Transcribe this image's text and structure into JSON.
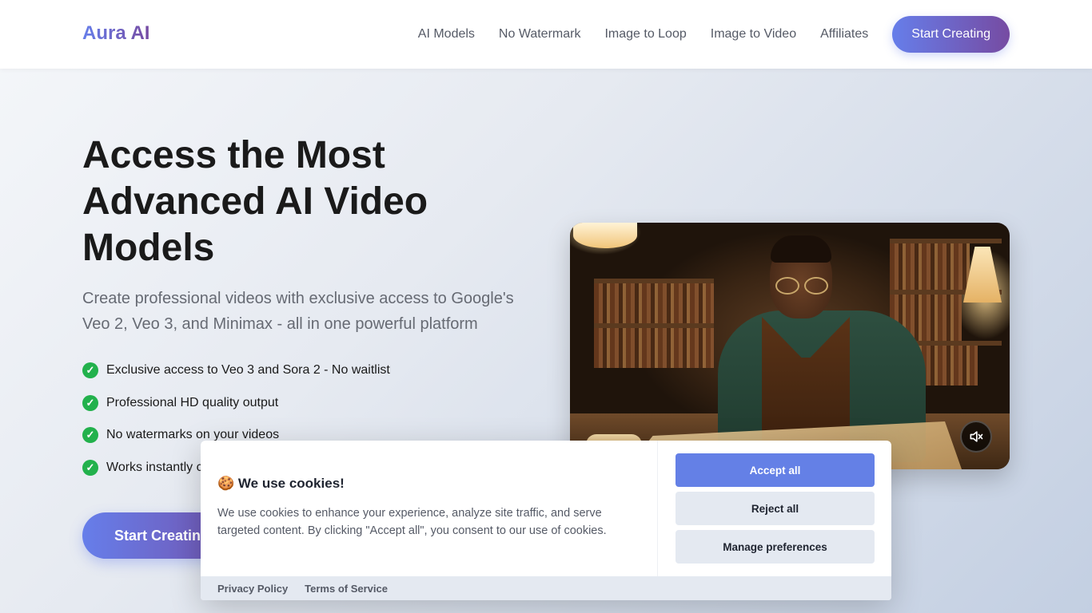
{
  "nav": {
    "logo": "Aura AI",
    "links": [
      "AI Models",
      "No Watermark",
      "Image to Loop",
      "Image to Video",
      "Affiliates"
    ],
    "cta": "Start Creating"
  },
  "hero": {
    "title": "Access the Most Advanced AI Video Models",
    "subtitle": "Create professional videos with exclusive access to Google's Veo 2, Veo 3, and Minimax - all in one powerful platform",
    "features": [
      "Exclusive access to Veo 3 and Sora 2 - No waitlist",
      "Professional HD quality output",
      "No watermarks on your videos",
      "Works instantly c"
    ],
    "cta": "Start Creatin"
  },
  "video": {
    "mute_icon": "volume-muted-icon"
  },
  "cookie": {
    "emoji": "🍪",
    "title": "We use cookies!",
    "text": "We use cookies to enhance your experience, analyze site traffic, and serve targeted content. By clicking \"Accept all\", you consent to our use of cookies.",
    "accept": "Accept all",
    "reject": "Reject all",
    "manage": "Manage preferences",
    "privacy": "Privacy Policy",
    "terms": "Terms of Service"
  },
  "colors": {
    "accent_start": "#667eea",
    "accent_end": "#764ba2",
    "check": "#22b14c",
    "accept_button": "#6480e6"
  }
}
